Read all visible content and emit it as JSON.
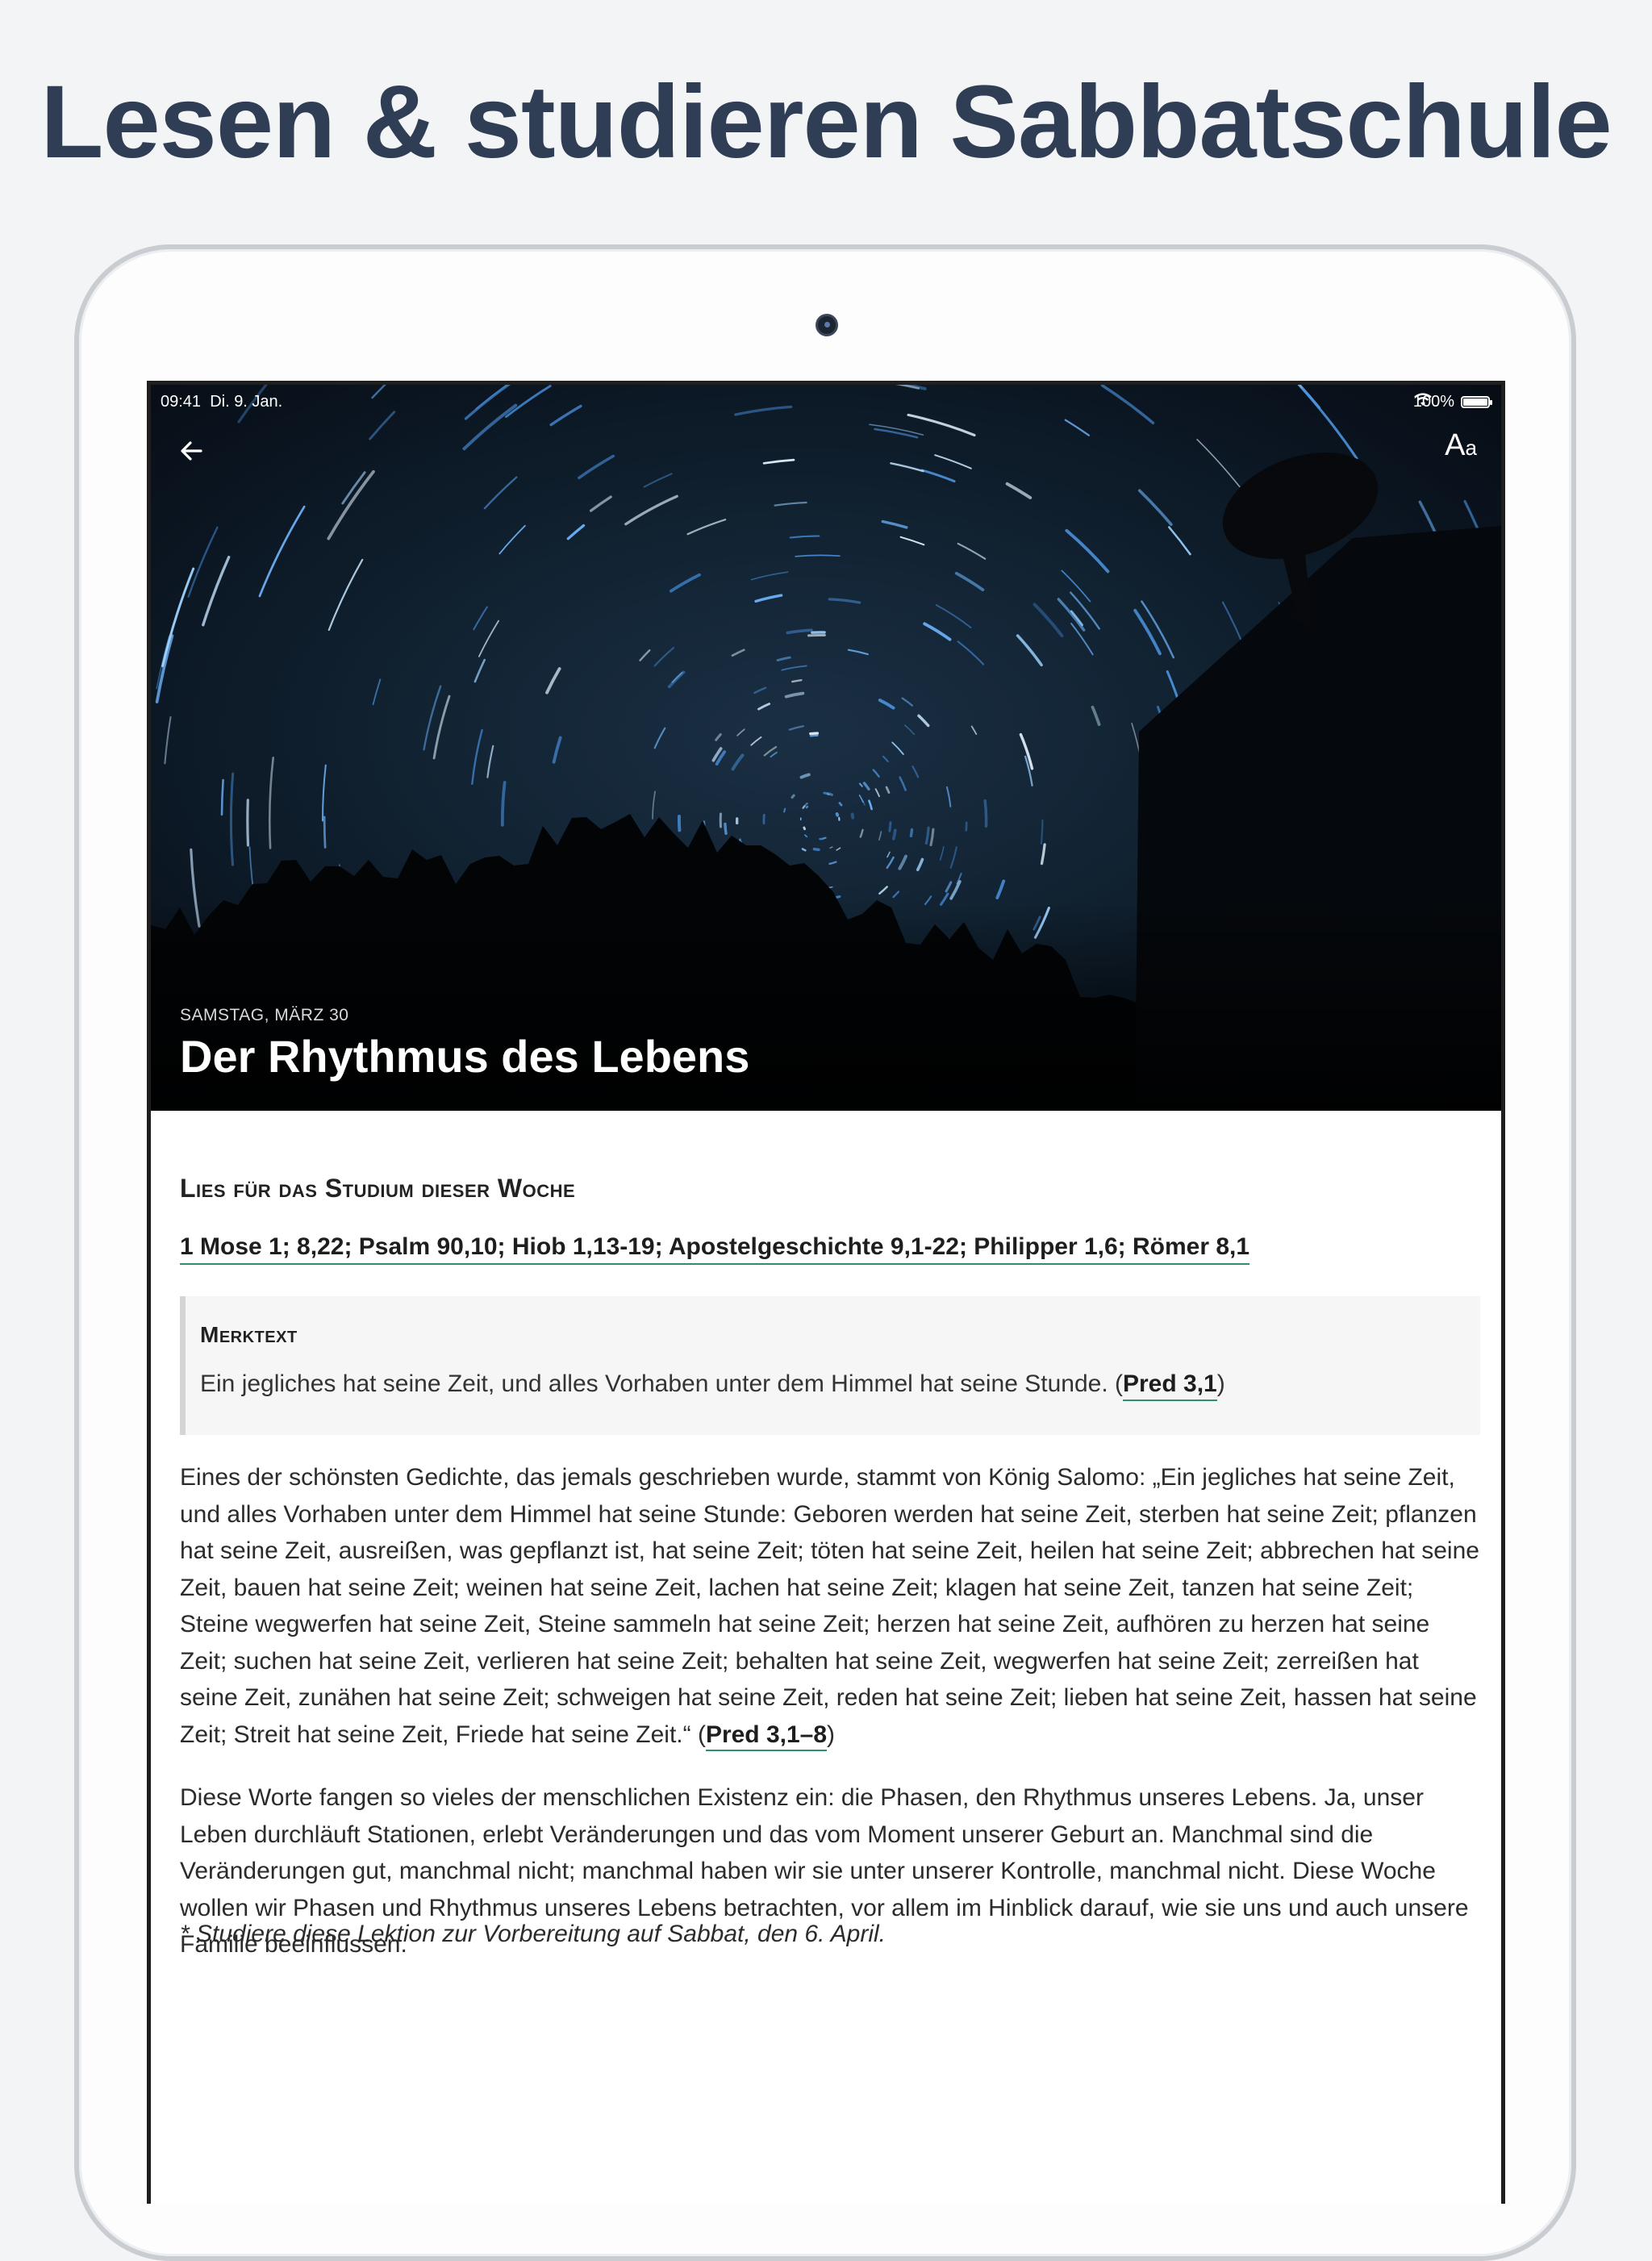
{
  "headline": "Lesen & studieren Sabbatschule",
  "status_bar": {
    "time": "09:41",
    "date": "Di. 9. Jan.",
    "battery": "100%"
  },
  "toolbar": {
    "font_size_label_big": "A",
    "font_size_label_small": "a"
  },
  "hero": {
    "date": "SAMSTAG, MÄRZ 30",
    "title": "Der Rhythmus des Lebens"
  },
  "reading": {
    "heading": "Lies für das Studium dieser Woche",
    "references": "1 Mose 1; 8,22; Psalm 90,10; Hiob 1,13-19; Apostelgeschichte 9,1-22; Philipper 1,6; Römer 8,1"
  },
  "memory": {
    "title": "Merktext",
    "text": "Ein jegliches hat seine Zeit, und alles Vorhaben unter dem Himmel hat seine Stunde. (",
    "reference": "Pred 3,1",
    "close": ")"
  },
  "paragraphs": {
    "p1": "Eines der schönsten Gedichte, das jemals geschrieben wurde, stammt von König Salomo: „Ein jegliches hat seine Zeit, und alles Vorhaben unter dem Himmel hat seine Stunde: Geboren werden hat seine Zeit, sterben hat seine Zeit; pflanzen hat seine Zeit, ausreißen, was gepflanzt ist, hat seine Zeit; töten hat seine Zeit, heilen hat seine Zeit; abbrechen hat seine Zeit, bauen hat seine Zeit; weinen hat seine Zeit, lachen hat seine Zeit; klagen hat seine Zeit, tanzen hat seine Zeit; Steine wegwerfen hat seine Zeit, Steine sammeln hat seine Zeit; herzen hat seine Zeit, aufhören zu herzen hat seine Zeit; suchen hat seine Zeit, verlieren hat seine Zeit; behalten hat seine Zeit, wegwerfen hat seine Zeit; zerreißen hat seine Zeit, zunähen hat seine Zeit; schweigen hat seine Zeit, reden hat seine Zeit; lieben hat seine Zeit, hassen hat seine Zeit; Streit hat seine Zeit, Friede hat seine Zeit.“ (",
    "p1_reference": "Pred 3,1–8",
    "p1_close": ")",
    "p2": "Diese Worte fangen so vieles der menschlichen Existenz ein: die Phasen, den Rhythmus unseres Lebens. Ja, unser Leben durchläuft Stationen, erlebt Veränderungen und das vom Moment unserer Geburt an. Manchmal sind die Veränderungen gut, manchmal nicht; manchmal haben wir sie unter unserer Kontrolle, manchmal nicht. Diese Woche wollen wir Phasen und Rhythmus unseres Lebens betrachten, vor allem im Hinblick darauf, wie sie uns und auch unsere Familie beeinflussen.",
    "note": "* Studiere diese Lektion zur Vorbereitung auf Sabbat, den 6. April."
  },
  "colors": {
    "headline": "#2f3d55",
    "link_underline": "#2e8f6e"
  }
}
